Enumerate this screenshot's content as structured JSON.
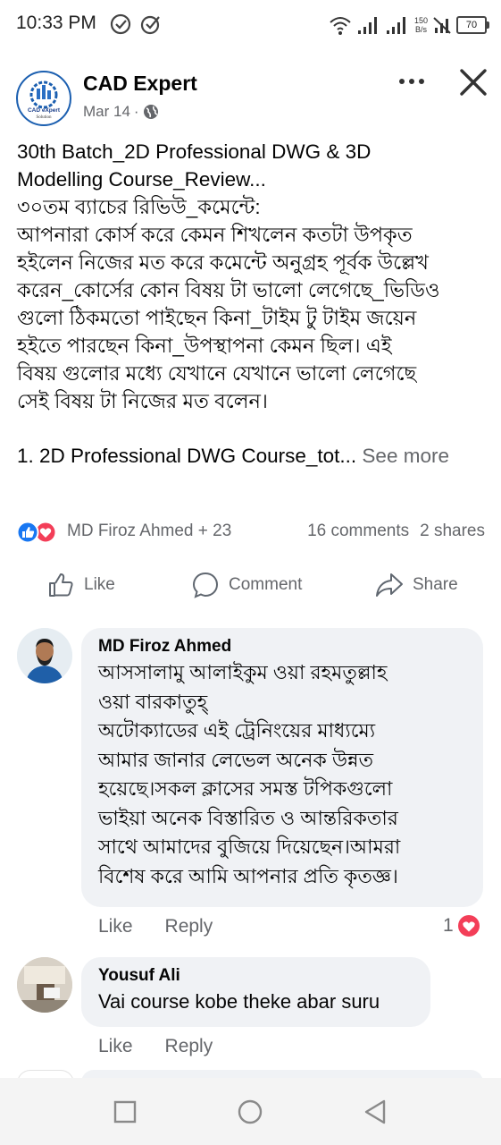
{
  "status_bar": {
    "time": "10:33 PM",
    "net_speed_value": "150",
    "net_speed_unit": "B/s",
    "battery": "70",
    "icons": [
      "check-circle-icon",
      "check-circle-icon",
      "wifi-icon",
      "signal-icon",
      "signal-icon",
      "no-signal-icon",
      "battery-icon"
    ]
  },
  "post": {
    "author": "CAD Expert",
    "avatar_text_main": "CAD eXpert",
    "avatar_text_sub": "Solution",
    "date": "Mar 14",
    "dot": "·",
    "audience_icon": "globe-icon",
    "lines": [
      "30th Batch_2D Professional DWG & 3D",
      "Modelling Course_Review...",
      "৩০তম ব্যাচের রিভিউ_কমেন্টে:",
      "আপনারা কোর্স করে কেমন শিখলেন কতটা উপকৃত",
      "হইলেন নিজের মত করে কমেন্টে অনুগ্রহ পূর্বক উল্লেখ",
      "করেন_কোর্সের কোন বিষয় টা ভালো লেগেছে_ভিডিও",
      "গুলো ঠিকমতো পাইছেন কিনা_টাইম টু টাইম জয়েন",
      "হইতে পারছেন কিনা_উপস্থাপনা কেমন ছিল। এই",
      "বিষয় গুলোর মধ্যে যেখানে যেখানে ভালো লেগেছে",
      "সেই বিষয় টা নিজের মত বলেন।"
    ],
    "last_line": "1. 2D Professional DWG Course_tot...",
    "see_more": "See more",
    "reactions": {
      "names": "MD Firoz Ahmed + 23",
      "comments": "16 comments",
      "shares": "2 shares",
      "icons": [
        "like-reaction-icon",
        "love-reaction-icon"
      ]
    },
    "actions": {
      "like": "Like",
      "comment": "Comment",
      "share": "Share"
    }
  },
  "comments": [
    {
      "name": "MD Firoz Ahmed",
      "lines": [
        "আসসালামু আলাইকুম ওয়া রহমতুল্লাহ",
        "ওয়া বারকাতুহ্",
        "অটোক্যাডের এই ট্রেনিংয়ের মাধ্যম্যে",
        "আমার জানার লেভেল অনেক উন্নত",
        "হয়েছে।সকল ক্লাসের সমস্ত টপিকগুলো",
        "ভাইয়া অনেক বিস্তারিত ও আন্তরিকতার",
        "সাথে আমাদের বুজিয়ে দিয়েছেন।আমরা",
        "বিশেষ করে আমি আপনার প্রতি কৃতজ্ঞ।"
      ],
      "like": "Like",
      "reply": "Reply",
      "reaction_count": "1"
    },
    {
      "name": "Yousuf Ali",
      "lines": [
        "Vai course kobe theke abar suru"
      ],
      "like": "Like",
      "reply": "Reply"
    }
  ],
  "colors": {
    "facebook_blue": "#1877f2",
    "love_red": "#f33e58",
    "secondary_text": "#65676b",
    "bubble_bg": "#f0f2f5"
  }
}
